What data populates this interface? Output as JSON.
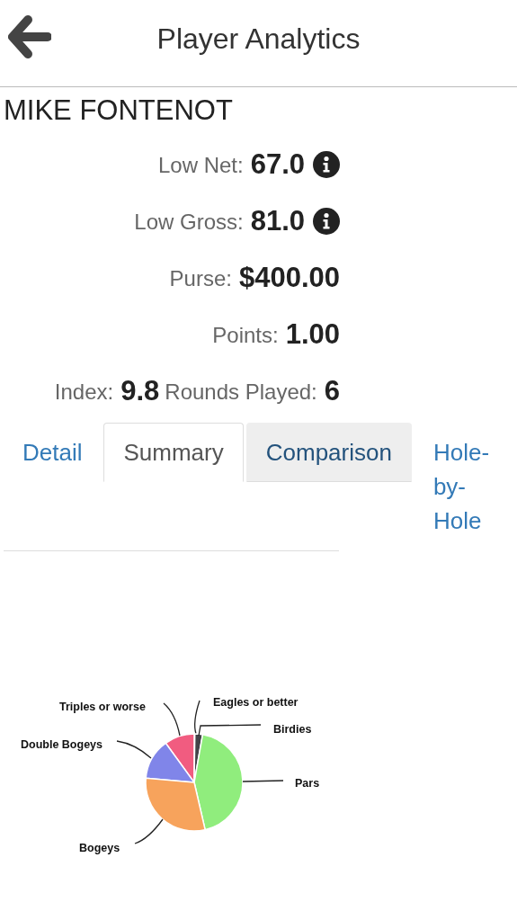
{
  "header": {
    "title": "Player Analytics"
  },
  "player": {
    "name": "MIKE FONTENOT"
  },
  "stats": [
    {
      "label": "Low Net:",
      "value": "67.0",
      "info": true
    },
    {
      "label": "Low Gross:",
      "value": "81.0",
      "info": true
    },
    {
      "label": "Purse:",
      "value": "$400.00",
      "info": false
    },
    {
      "label": "Points:",
      "value": "1.00",
      "info": false
    }
  ],
  "index_row": [
    {
      "label": "Index:",
      "value": "9.8"
    },
    {
      "label": "Rounds Played:",
      "value": "6"
    }
  ],
  "tabs": [
    {
      "label": "Detail",
      "selected": false,
      "hovered": false
    },
    {
      "label": "Summary",
      "selected": true,
      "hovered": false
    },
    {
      "label": "Comparison",
      "selected": false,
      "hovered": true
    },
    {
      "label": "Hole-by-Hole",
      "selected": false,
      "hovered": false
    }
  ],
  "pie": {
    "slices": [
      {
        "label": "Eagles or better"
      },
      {
        "label": "Triples or worse",
        "color": "#f15c80"
      },
      {
        "label": "Birdies",
        "color": "#434348"
      },
      {
        "label": "Double Bogeys",
        "color": "#8085e9"
      },
      {
        "label": "Pars",
        "color": "#90ed7d"
      },
      {
        "label": "Bogeys",
        "color": "#f7a35c"
      }
    ]
  }
}
